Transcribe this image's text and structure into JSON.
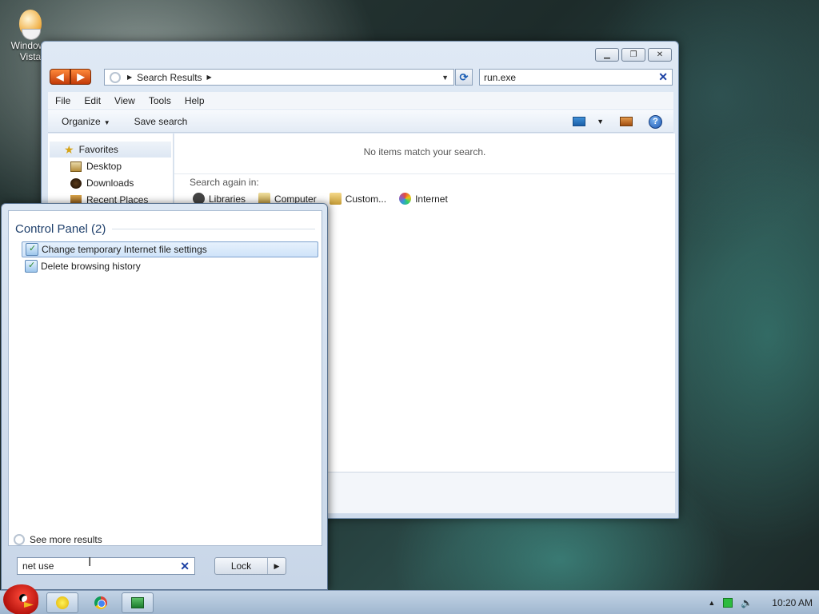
{
  "desktop": {
    "icon_label": "Windows Vista"
  },
  "explorer": {
    "address": {
      "crumb": "Search Results"
    },
    "search_value": "run.exe",
    "menu": [
      "File",
      "Edit",
      "View",
      "Tools",
      "Help"
    ],
    "toolbar": {
      "organize": "Organize",
      "save_search": "Save search"
    },
    "nav": {
      "favorites": "Favorites",
      "items": [
        "Desktop",
        "Downloads",
        "Recent Places"
      ]
    },
    "content": {
      "no_items": "No items match your search.",
      "search_again": "Search again in:",
      "locations": [
        "Libraries",
        "Computer",
        "Custom...",
        "Internet"
      ]
    }
  },
  "start_panel": {
    "header": "Control Panel (2)",
    "results": [
      "Change temporary Internet file settings",
      "Delete browsing history"
    ],
    "see_more": "See more results",
    "search_value": "net use",
    "lock_label": "Lock"
  },
  "taskbar": {
    "clock": "10:20 AM"
  },
  "colors": {
    "accent": "#1d5fb5",
    "nav_button": "#c23a08",
    "selection_border": "#7da2ce"
  }
}
